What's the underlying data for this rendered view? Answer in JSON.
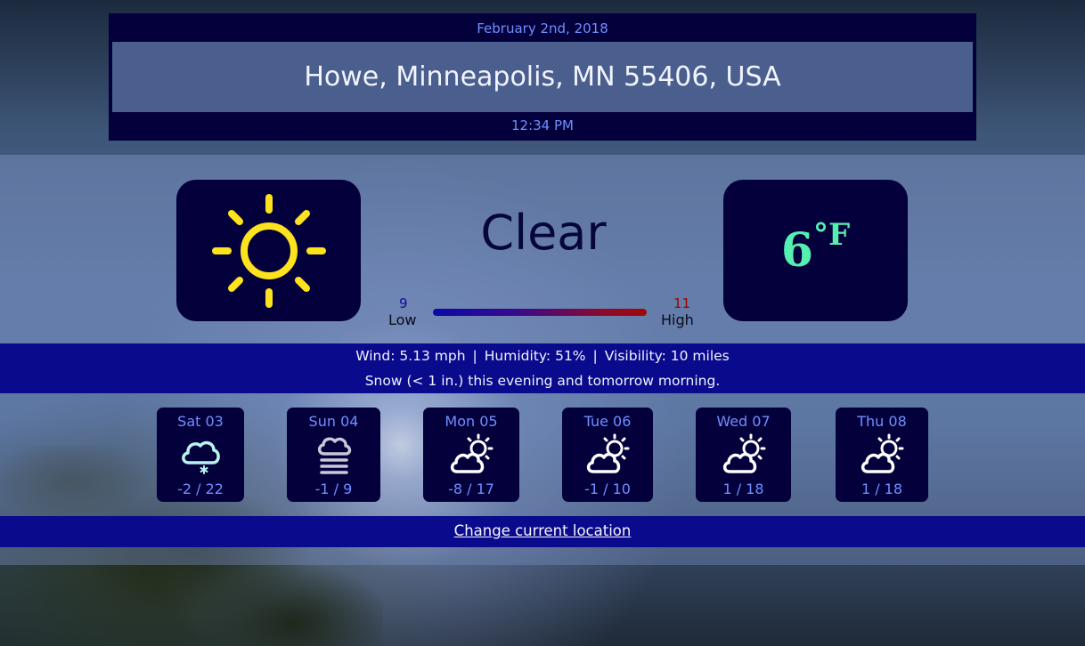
{
  "header": {
    "date": "February 2nd, 2018",
    "location": "Howe, Minneapolis, MN 55406, USA",
    "time": "12:34 PM"
  },
  "current": {
    "icon": "sun-icon",
    "summary": "Clear",
    "temperature": "6",
    "unit": "°F",
    "low": "9",
    "low_label": "Low",
    "high": "11",
    "high_label": "High"
  },
  "details": {
    "wind": "Wind:  5.13 mph",
    "humidity": "Humidity:  51%",
    "visibility": "Visibility:  10 miles",
    "forecast_text": "Snow (< 1 in.) this evening and tomorrow morning."
  },
  "forecast": [
    {
      "day": "Sat 03",
      "icon": "cloud-snow-icon",
      "temps": "-2 / 22"
    },
    {
      "day": "Sun 04",
      "icon": "fog-icon",
      "temps": "-1 / 9"
    },
    {
      "day": "Mon 05",
      "icon": "partly-cloudy-icon",
      "temps": "-8 / 17"
    },
    {
      "day": "Tue 06",
      "icon": "partly-cloudy-icon",
      "temps": "-1 / 10"
    },
    {
      "day": "Wed 07",
      "icon": "partly-cloudy-icon",
      "temps": "1 / 18"
    },
    {
      "day": "Thu 08",
      "icon": "partly-cloudy-icon",
      "temps": "1 / 18"
    }
  ],
  "footer": {
    "change_location": "Change current location"
  },
  "colors": {
    "panel": "#04003c",
    "accent_blue": "#6f8fff",
    "bar_blue": "#0a0a8c",
    "temp_green": "#55f0b0",
    "sun_yellow": "#fde31e",
    "low_color": "#0d0d9a",
    "high_color": "#a00000"
  }
}
